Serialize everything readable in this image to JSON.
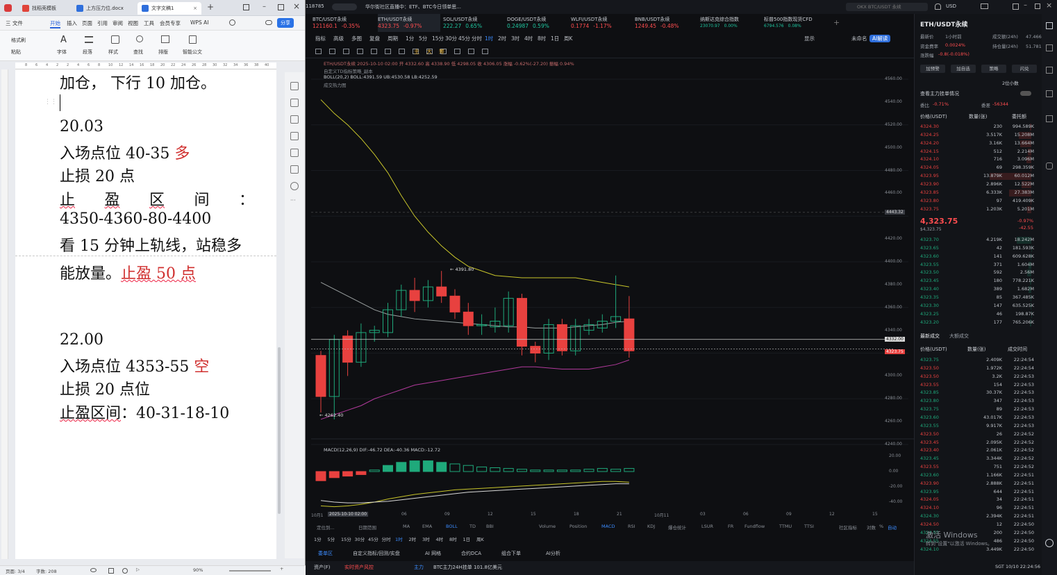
{
  "wps": {
    "tabs": [
      {
        "label": "找稻壳模板"
      },
      {
        "label": "上方压力位.docx"
      },
      {
        "label": "文字文稿1"
      }
    ],
    "menu": [
      "三 文件",
      "开始",
      "插入",
      "页面",
      "引用",
      "审阅",
      "视图",
      "工具",
      "会员专享",
      "WPS AI"
    ],
    "share": "分享",
    "tools": [
      "格式刷",
      "粘贴",
      "字体",
      "段落",
      "样式",
      "查找",
      "排版",
      "智能公文"
    ],
    "ruler": [
      "8",
      "6",
      "4",
      "2",
      "2",
      "4",
      "6",
      "8",
      "10",
      "12",
      "14",
      "16",
      "18",
      "20",
      "22",
      "24",
      "26",
      "28",
      "30",
      "32",
      "34",
      "36",
      "38",
      "40"
    ],
    "doc": {
      "l0": "加仓， 下行 10 加仓。",
      "l1": "20.03",
      "l2a": "入场点位 40-35 ",
      "l2b": "多",
      "l3": "止损 20 点",
      "l4": [
        "止",
        "盈",
        "区",
        "间",
        "："
      ],
      "l5": "4350-4360-80-4400",
      "l6": "看 15 分钟上轨线，站稳多",
      "l7a": "能放量。",
      "l7b": "止盈 50 点",
      "l8": "22.00",
      "l9a": "入场点位 4353-55 ",
      "l9b": "空",
      "l10": "止损 20 点位",
      "l11a": "止盈区间",
      "l11b": "：40-31-18-10"
    },
    "status": {
      "page": "页面: 3/4",
      "words": "字数: 208",
      "zoom": "90%"
    }
  },
  "trade": {
    "topleft": "118785",
    "news": "华尔街社区直播中：ETF、BTC今日领单思...",
    "search": "OKX BTC/USDT 永续",
    "currency": "USD",
    "symbols": [
      {
        "name": "BTC/USDT永续",
        "price": "121160.1",
        "chg": "-0.35%"
      },
      {
        "name": "ETH/USDT永续",
        "price": "4323.75",
        "chg": "-0.97%"
      },
      {
        "name": "SOL/USDT永续",
        "price": "222.27",
        "chg": "0.65%"
      },
      {
        "name": "DOGE/USDT永续",
        "price": "0.24987",
        "chg": "0.59%"
      },
      {
        "name": "WLFI/USDT永续",
        "price": "0.1774",
        "chg": "-1.17%"
      },
      {
        "name": "BNB/USDT永续",
        "price": "1249.45",
        "chg": "-0.48%"
      },
      {
        "name": "纳斯达克综合指数",
        "price": "23070.97",
        "chg": "0.00%"
      },
      {
        "name": "标普500指数现货CFD",
        "price": "6794.576",
        "chg": "0.08%"
      }
    ],
    "toolbar1": [
      "指标",
      "高级",
      "多图",
      "复盘",
      "周期",
      "1分",
      "5分",
      "15分",
      "30分",
      "45分",
      "分时",
      "1时",
      "2时",
      "3时",
      "4时",
      "8时",
      "1日",
      "周K"
    ],
    "toolbar1_right": [
      "显示",
      "未命名",
      "AI解读"
    ],
    "chart_info": {
      "line1": "ETH/USDT永续 2025-10-10 02:00 开 4332.60 高 4338.90 低 4298.05 收 4306.05 涨幅 -0.62%(-27.20) 振幅 0.94%",
      "line2": "自定义TD指标策略_副本",
      "line3": "BOLL(20,2) BOLL:4391.59 UB:4530.58 LB:4252.59",
      "line4": "成交热力图",
      "hi_label": "4391.80",
      "lo_label": "4262.40",
      "macd": "MACD(12,26,9) DIF:-46.72 DEA:-40.36 MACD:-12.72"
    },
    "price_axis": [
      "4560.00",
      "4540.00",
      "4520.00",
      "4500.00",
      "4480.00",
      "4460.00",
      "4443.32",
      "4420.00",
      "4400.00",
      "4380.00",
      "4360.00",
      "4340.00",
      "4332.00",
      "4323.75",
      "4300.00",
      "4280.00",
      "4260.00",
      "4240.00"
    ],
    "macd_axis": [
      "20.00",
      "0.00",
      "-20.00",
      "-40.00"
    ],
    "time_axis": [
      "10月1",
      "2025-10-10 02:00",
      "06",
      "09",
      "12",
      "15",
      "18",
      "21",
      "10月11",
      "03",
      "06",
      "09",
      "12",
      "15"
    ],
    "bottom_tabs": [
      "定位到...",
      "日期范围",
      "MA",
      "EMA",
      "BOLL",
      "TD",
      "BBI",
      "Volume",
      "Position",
      "MACD",
      "RSI",
      "KDJ",
      "爆仓统计",
      "LSUR",
      "FR",
      "Fundflow",
      "TTMU",
      "TTSI",
      "社区指标",
      "对数",
      "%",
      "自动"
    ],
    "bottom_periods": [
      "1分",
      "5分",
      "15分",
      "30分",
      "45分",
      "分时",
      "1时",
      "2时",
      "3时",
      "4时",
      "8时",
      "1日",
      "周K"
    ],
    "bottom_menu": [
      "委单区",
      "自定义指标/回测/实盘",
      "AI 网格",
      "合约DCA",
      "组合下单",
      "AI分析"
    ],
    "footer": {
      "a": "资产(F)",
      "b": "实时资产风控",
      "c": "主力",
      "d": "BTC主力24H挂单 101.8亿美元"
    },
    "book": {
      "title": "ETH/USDT永续",
      "stats": [
        "最新价",
        "1小时前",
        "成交额(24h)",
        "47.466亿",
        "资金费率",
        "0.0024%",
        "持仓量(24h)",
        "51.781亿",
        "涨跌幅",
        "-0.8(-0.018%)"
      ],
      "buttons": [
        "加预警",
        "加自选",
        "策略",
        "闪兑"
      ],
      "decimals": "2位小数",
      "depth": "查看主力挂单情况",
      "ratio": [
        "委比",
        "-0.71%",
        "委差",
        "-56344"
      ],
      "head": [
        "价格(USDT)",
        "数量(张)",
        "委托额"
      ],
      "asks": [
        [
          "4324.30",
          "230",
          "994.589K"
        ],
        [
          "4324.25",
          "3.517K",
          "15.208M"
        ],
        [
          "4324.20",
          "3.16K",
          "13.664M"
        ],
        [
          "4324.15",
          "512",
          "2.214M"
        ],
        [
          "4324.10",
          "716",
          "3.096M"
        ],
        [
          "4324.05",
          "69",
          "298.359K"
        ],
        [
          "4323.95",
          "13.879K",
          "60.012M"
        ],
        [
          "4323.90",
          "2.896K",
          "12.522M"
        ],
        [
          "4323.85",
          "6.333K",
          "27.383M"
        ],
        [
          "4323.80",
          "97",
          "419.409K"
        ],
        [
          "4323.75",
          "1.203K",
          "5.201M"
        ]
      ],
      "last": "4,323.75",
      "last_sub": "$4,323.75",
      "last_chg": "-0.97%",
      "last_chg2": "-42.55",
      "bids": [
        [
          "4323.70",
          "4.219K",
          "18.242M"
        ],
        [
          "4323.65",
          "42",
          "181.593K"
        ],
        [
          "4323.60",
          "141",
          "609.628K"
        ],
        [
          "4323.55",
          "371",
          "1.604M"
        ],
        [
          "4323.50",
          "592",
          "2.56M"
        ],
        [
          "4323.45",
          "180",
          "778.221K"
        ],
        [
          "4323.40",
          "389",
          "1.682M"
        ],
        [
          "4323.35",
          "85",
          "367.485K"
        ],
        [
          "4323.30",
          "147",
          "635.525K"
        ],
        [
          "4323.25",
          "46",
          "198.87K"
        ],
        [
          "4323.20",
          "177",
          "765.206K"
        ]
      ],
      "trades_tabs": [
        "最新成交",
        "大额成交"
      ],
      "trades_head": [
        "价格(USDT)",
        "数量(张)",
        "成交时间"
      ],
      "trades": [
        [
          "4323.75",
          "2.409K",
          "22:24:54",
          "g"
        ],
        [
          "4323.50",
          "1.972K",
          "22:24:54",
          "r"
        ],
        [
          "4323.50",
          "3.2K",
          "22:24:53",
          "r"
        ],
        [
          "4323.55",
          "154",
          "22:24:53",
          "r"
        ],
        [
          "4323.85",
          "30.37K",
          "22:24:53",
          "g"
        ],
        [
          "4323.80",
          "347",
          "22:24:53",
          "g"
        ],
        [
          "4323.75",
          "89",
          "22:24:53",
          "g"
        ],
        [
          "4323.60",
          "43.017K",
          "22:24:53",
          "g"
        ],
        [
          "4323.55",
          "9.917K",
          "22:24:53",
          "g"
        ],
        [
          "4323.50",
          "26",
          "22:24:52",
          "r"
        ],
        [
          "4323.45",
          "2.095K",
          "22:24:52",
          "r"
        ],
        [
          "4323.40",
          "2.061K",
          "22:24:52",
          "r"
        ],
        [
          "4323.45",
          "3.344K",
          "22:24:52",
          "g"
        ],
        [
          "4323.55",
          "751",
          "22:24:52",
          "r"
        ],
        [
          "4323.60",
          "1.166K",
          "22:24:51",
          "g"
        ],
        [
          "4323.90",
          "2.888K",
          "22:24:51",
          "r"
        ],
        [
          "4323.95",
          "644",
          "22:24:51",
          "g"
        ],
        [
          "4324.05",
          "34",
          "22:24:51",
          "r"
        ],
        [
          "4324.10",
          "96",
          "22:24:51",
          "r"
        ],
        [
          "4324.30",
          "2.394K",
          "22:24:51",
          "g"
        ],
        [
          "4324.50",
          "12",
          "22:24:50",
          "r"
        ],
        [
          "4324.55",
          "200",
          "22:24:50",
          "g"
        ],
        [
          "4324.55",
          "486",
          "22:24:50",
          "g"
        ],
        [
          "4324.10",
          "3.449K",
          "22:24:50",
          "g"
        ]
      ],
      "watermark1": "激活 Windows",
      "watermark2": "转到\"设置\"以激活 Windows。",
      "tray": "SGT 10/10 22:24:56"
    }
  },
  "chart_data": {
    "type": "candlestick",
    "title": "ETH/USDT永续",
    "ylim": [
      4240,
      4560
    ],
    "candles": [
      {
        "o": 4318,
        "c": 4282,
        "h": 4322,
        "l": 4268
      },
      {
        "o": 4282,
        "c": 4332,
        "h": 4336,
        "l": 4262
      },
      {
        "o": 4335,
        "c": 4312,
        "h": 4340,
        "l": 4300
      },
      {
        "o": 4312,
        "c": 4338,
        "h": 4346,
        "l": 4308
      },
      {
        "o": 4338,
        "c": 4340,
        "h": 4344,
        "l": 4330
      },
      {
        "o": 4338,
        "c": 4358,
        "h": 4364,
        "l": 4334
      },
      {
        "o": 4358,
        "c": 4375,
        "h": 4380,
        "l": 4352
      },
      {
        "o": 4375,
        "c": 4366,
        "h": 4386,
        "l": 4356
      },
      {
        "o": 4366,
        "c": 4378,
        "h": 4384,
        "l": 4360
      },
      {
        "o": 4378,
        "c": 4370,
        "h": 4392,
        "l": 4364
      },
      {
        "o": 4370,
        "c": 4356,
        "h": 4376,
        "l": 4350
      },
      {
        "o": 4356,
        "c": 4344,
        "h": 4364,
        "l": 4336
      },
      {
        "o": 4344,
        "c": 4345,
        "h": 4354,
        "l": 4336
      },
      {
        "o": 4343,
        "c": 4348,
        "h": 4360,
        "l": 4338
      },
      {
        "o": 4344,
        "c": 4368,
        "h": 4374,
        "l": 4338
      },
      {
        "o": 4368,
        "c": 4326,
        "h": 4372,
        "l": 4318
      },
      {
        "o": 4326,
        "c": 4320,
        "h": 4330,
        "l": 4312
      },
      {
        "o": 4320,
        "c": 4345,
        "h": 4350,
        "l": 4314
      },
      {
        "o": 4345,
        "c": 4322,
        "h": 4350,
        "l": 4318
      },
      {
        "o": 4322,
        "c": 4344,
        "h": 4350,
        "l": 4318
      },
      {
        "o": 4340,
        "c": 4345,
        "h": 4350,
        "l": 4336
      },
      {
        "o": 4342,
        "c": 4348,
        "h": 4354,
        "l": 4338
      },
      {
        "o": 4348,
        "c": 4352,
        "h": 4388,
        "l": 4342
      },
      {
        "o": 4350,
        "c": 4322,
        "h": 4370,
        "l": 4316
      }
    ],
    "boll_ub": [
      4542,
      4530,
      4520,
      4508,
      4494,
      4478,
      4458,
      4440,
      4426,
      4414,
      4404,
      4396,
      4392,
      4388,
      4387,
      4386,
      4386,
      4386,
      4386,
      4386,
      4384,
      4382,
      4380,
      4378
    ],
    "boll_mid": [
      4382,
      4376,
      4370,
      4364,
      4358,
      4354,
      4352,
      4350,
      4349,
      4348,
      4347,
      4346,
      4345,
      4344,
      4343,
      4343,
      4342,
      4342,
      4342,
      4343,
      4344,
      4345,
      4347,
      4348
    ],
    "boll_lb": [
      4262,
      4266,
      4270,
      4274,
      4280,
      4284,
      4288,
      4292,
      4294,
      4296,
      4298,
      4300,
      4302,
      4304,
      4306,
      4308,
      4308,
      4307,
      4306,
      4306,
      4306,
      4308,
      4310,
      4314
    ],
    "macd": [
      -12,
      -8,
      -6,
      -4,
      2,
      8,
      12,
      14,
      14,
      12,
      10,
      8,
      6,
      5,
      4,
      3,
      2,
      2,
      2,
      2,
      3,
      4,
      3,
      4
    ],
    "dif": [
      -45,
      -46,
      -45,
      -43,
      -40,
      -36,
      -33,
      -30,
      -28,
      -26,
      -24,
      -23,
      -22,
      -21,
      -20,
      -19,
      -18,
      -17,
      -16,
      -15,
      -14,
      -13,
      -13,
      -14
    ],
    "dea": [
      -38,
      -40,
      -41,
      -41,
      -40,
      -39,
      -37,
      -35,
      -33,
      -31,
      -29,
      -27,
      -26,
      -25,
      -24,
      -23,
      -22,
      -21,
      -20,
      -19,
      -18,
      -17,
      -16,
      -16
    ]
  }
}
